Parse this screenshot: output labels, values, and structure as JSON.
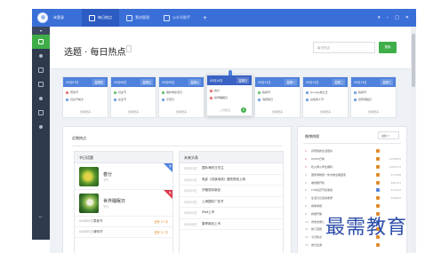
{
  "titlebar": {
    "app_name": "未登录",
    "tabs": [
      {
        "label": "每日热点",
        "active": true
      },
      {
        "label": "素材管理",
        "active": false
      },
      {
        "label": "公众号助手",
        "active": false
      }
    ],
    "add_tab": "+",
    "controls": [
      "▾",
      "–",
      "□",
      "✕"
    ]
  },
  "header": {
    "title": "选题 · 每日热点",
    "search_placeholder": "每日热点",
    "search_button": "搜索"
  },
  "date_cards": [
    {
      "date": "03月07日",
      "weekday": "星期四",
      "items": [
        {
          "text": "劳动节",
          "color": "red"
        },
        {
          "text": "妇女节前夕",
          "color": "blue"
        }
      ],
      "more": "查看更多"
    },
    {
      "date": "03月08日",
      "weekday": "星期五",
      "items": [
        {
          "text": "妇女节",
          "color": "green"
        },
        {
          "text": "女生节",
          "color": "blue"
        }
      ],
      "more": "查看更多"
    },
    {
      "date": "03月09日",
      "weekday": "星期六",
      "items": [
        {
          "text": "保护母亲河日",
          "color": "green"
        },
        {
          "text": "平安日",
          "color": "blue"
        }
      ],
      "more": "查看更多"
    },
    {
      "date": "03月10日",
      "weekday": "星期日",
      "items": [
        {
          "text": "春分",
          "color": "red"
        },
        {
          "text": "世界睡眠日",
          "color": "red"
        }
      ],
      "more": "二月初五",
      "badge": "6",
      "today": true
    },
    {
      "date": "03月11日",
      "weekday": "星期一",
      "items": [
        {
          "text": "植树节",
          "color": "green"
        },
        {
          "text": "消费者日",
          "color": "blue"
        }
      ],
      "more": "查看更多"
    },
    {
      "date": "03月12日",
      "weekday": "星期二",
      "items": [
        {
          "text": "Google成立日",
          "color": "blue"
        },
        {
          "text": "白色情人节",
          "color": "blue"
        }
      ],
      "more": "查看更多"
    },
    {
      "date": "03月13日",
      "weekday": "星期三",
      "items": [
        {
          "text": "植树节",
          "color": "blue"
        },
        {
          "text": "世界肾脏日",
          "color": "blue"
        }
      ],
      "more": "查看更多"
    }
  ],
  "recent": {
    "title": "近期热点",
    "festivals": {
      "title": "节日话题",
      "cards": [
        {
          "name": "春分",
          "sub": "节气",
          "img": "spring",
          "corner": "热",
          "corner_color": "blue"
        },
        {
          "name": "世界睡眠日",
          "sub": "节日",
          "img": "earth",
          "corner": "热",
          "corner_color": "red"
        }
      ],
      "rows": [
        {
          "date": "04月05日",
          "name": "寒食节",
          "count": "还有 11 天"
        },
        {
          "date": "04月05日",
          "name": "清明节",
          "count": "还有 11 天"
        }
      ]
    },
    "todo": {
      "title": "未来头条",
      "rows": [
        {
          "date": "03月22日",
          "text": "国际海豹日关注"
        },
        {
          "date": "03月22日",
          "text": "电影《流浪地球》登陆院线上映"
        },
        {
          "date": "03月23日",
          "text": "开箱测评新品"
        },
        {
          "date": "03月23日",
          "text": "上海国际广告节"
        },
        {
          "date": "03月25日",
          "text": "iPad上市"
        },
        {
          "date": "03月26日",
          "text": "春季新品上市"
        }
      ]
    }
  },
  "hot": {
    "title": "微博热搜",
    "select": "最新",
    "rows": [
      {
        "rank": "1",
        "text": "养老院的生活很好",
        "tag": "orange",
        "num": ""
      },
      {
        "rank": "2",
        "text": "OOTD日常",
        "tag": "orange",
        "num": "1058899"
      },
      {
        "rank": "3",
        "text": "吃火锅小学生爆料",
        "tag": "orange",
        "num": "1045279"
      },
      {
        "rank": "4",
        "text": "国家博物馆一件文物全程回家",
        "tag": "orange",
        "num": "527488"
      },
      {
        "rank": "5",
        "text": "电视剧开机",
        "tag": "orange",
        "num": "466724"
      },
      {
        "rank": "6",
        "text": "TVB演员节目收视",
        "tag": "blue",
        "num": "427002"
      },
      {
        "rank": "7",
        "text": "生活日记说说收录",
        "tag": "orange",
        "num": "398402"
      },
      {
        "rank": "8",
        "text": "春季穿搭",
        "tag": "orange",
        "num": ""
      },
      {
        "rank": "9",
        "text": "新剧开播",
        "tag": "orange",
        "num": ""
      },
      {
        "rank": "10",
        "text": "周末去哪儿",
        "tag": "blue",
        "num": ""
      },
      {
        "rank": "11",
        "text": "热门话题",
        "tag": "orange",
        "num": ""
      },
      {
        "rank": "12",
        "text": "今日热点",
        "tag": "orange",
        "num": ""
      },
      {
        "rank": "13",
        "text": "春日出游",
        "tag": "orange",
        "num": ""
      }
    ]
  },
  "watermark": "最需教育"
}
